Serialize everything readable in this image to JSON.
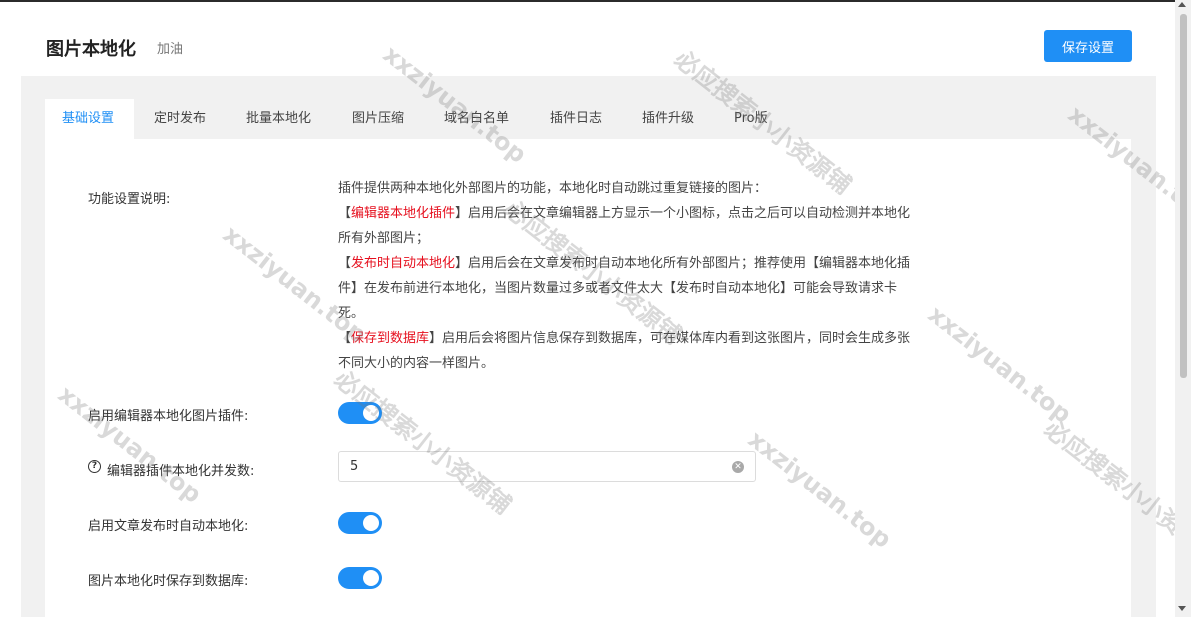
{
  "header": {
    "title": "图片本地化",
    "subtitle": "加油",
    "save_label": "保存设置"
  },
  "tabs": [
    {
      "label": "基础设置",
      "active": true
    },
    {
      "label": "定时发布",
      "active": false
    },
    {
      "label": "批量本地化",
      "active": false
    },
    {
      "label": "图片压缩",
      "active": false
    },
    {
      "label": "域名白名单",
      "active": false
    },
    {
      "label": "插件日志",
      "active": false
    },
    {
      "label": "插件升级",
      "active": false
    },
    {
      "label": "Pro版",
      "active": false
    }
  ],
  "form": {
    "description_label": "功能设置说明:",
    "description": {
      "l1": "插件提供两种本地化外部图片的功能，本地化时自动跳过重复链接的图片：",
      "l2_open": "【",
      "l2_red": "编辑器本地化插件",
      "l2_rest": "】启用后会在文章编辑器上方显示一个小图标，点击之后可以自动检测并本地化",
      "l3": "所有外部图片；",
      "l4_open": "【",
      "l4_red": "发布时自动本地化",
      "l4_rest": "】启用后会在文章发布时自动本地化所有外部图片；推荐使用【编辑器本地化插",
      "l5": "件】在发布前进行本地化，当图片数量过多或者文件太大【发布时自动本地化】可能会导致请求卡",
      "l6": "死。",
      "l7_open": "【",
      "l7_red": "保存到数据库",
      "l7_rest": "】启用后会将图片信息保存到数据库，可在媒体库内看到这张图片，同时会生成多张",
      "l8": "不同大小的内容一样图片。"
    },
    "editor_plugin_label": "启用编辑器本地化图片插件:",
    "editor_plugin_enabled": true,
    "concurrency_label": "编辑器插件本地化并发数:",
    "concurrency_value": "5",
    "auto_publish_label": "启用文章发布时自动本地化:",
    "auto_publish_enabled": true,
    "save_db_label": "图片本地化时保存到数据库:",
    "save_db_enabled": true
  },
  "watermarks": [
    "xxziyuan.top",
    "必应搜索小小资源铺"
  ],
  "colors": {
    "accent": "#1f8ff5",
    "highlight": "#e6101f"
  }
}
